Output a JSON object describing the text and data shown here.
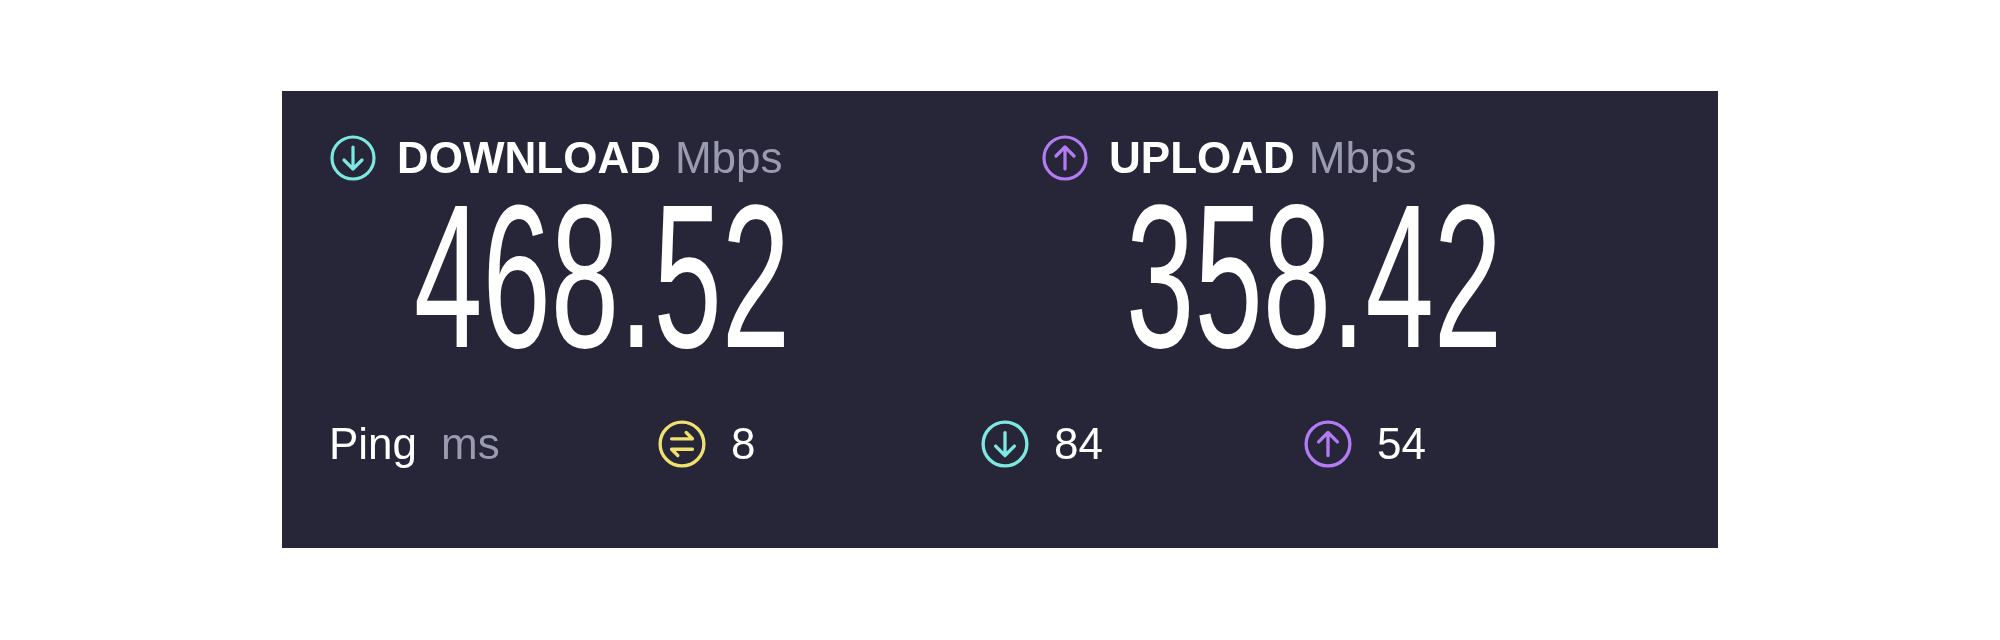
{
  "metrics": [
    {
      "kind": "download",
      "label": "DOWNLOAD",
      "unit": "Mbps",
      "value": "468.52",
      "color": "#7de8df"
    },
    {
      "kind": "upload",
      "label": "UPLOAD",
      "unit": "Mbps",
      "value": "358.42",
      "color": "#b37cf4"
    }
  ],
  "ping": {
    "label": "Ping",
    "unit": "ms",
    "items": [
      {
        "kind": "ping",
        "value": "8",
        "color": "#efe070"
      },
      {
        "kind": "download",
        "value": "84",
        "color": "#7de8df"
      },
      {
        "kind": "upload",
        "value": "54",
        "color": "#b37cf4"
      }
    ]
  }
}
